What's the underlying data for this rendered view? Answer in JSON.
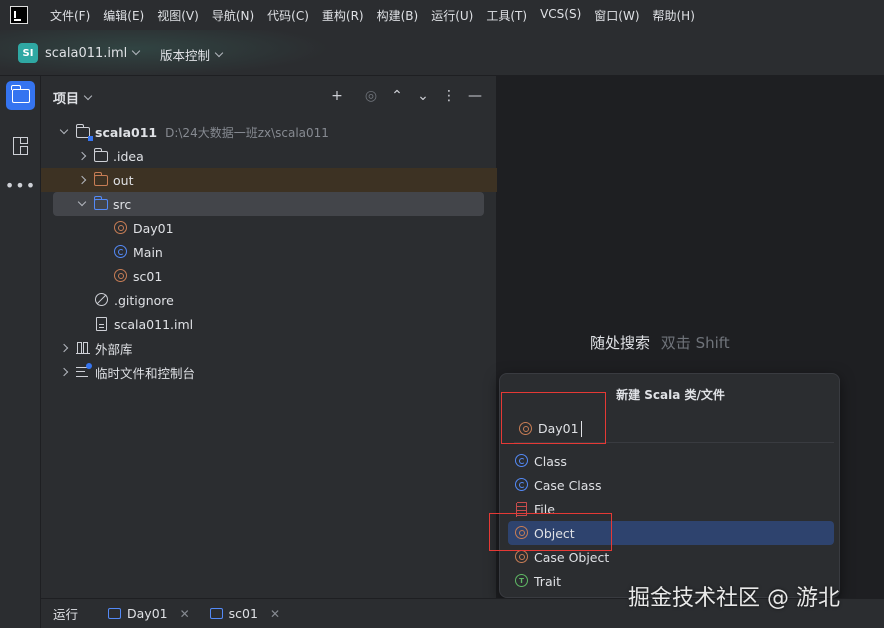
{
  "menu": {
    "items": [
      "文件(F)",
      "编辑(E)",
      "视图(V)",
      "导航(N)",
      "代码(C)",
      "重构(R)",
      "构建(B)",
      "运行(U)",
      "工具(T)",
      "VCS(S)",
      "窗口(W)",
      "帮助(H)"
    ]
  },
  "titlebar": {
    "project_badge": "SI",
    "project_name": "scala011.iml",
    "vcs_label": "版本控制"
  },
  "project_panel": {
    "title": "项目",
    "tree": [
      {
        "label": "scala011",
        "path": "D:\\24大数据一班zx\\scala011"
      },
      {
        "label": ".idea"
      },
      {
        "label": "out"
      },
      {
        "label": "src"
      },
      {
        "label": "Day01"
      },
      {
        "label": "Main"
      },
      {
        "label": "sc01"
      },
      {
        "label": ".gitignore"
      },
      {
        "label": "scala011.iml"
      },
      {
        "label": "外部库"
      },
      {
        "label": "临时文件和控制台"
      }
    ]
  },
  "editor": {
    "search_hint": "随处搜索",
    "search_hint_key": "双击 Shift"
  },
  "popup": {
    "title": "新建 Scala 类/文件",
    "input_value": "Day01",
    "options": [
      "Class",
      "Case Class",
      "File",
      "Object",
      "Case Object",
      "Trait"
    ],
    "selected": "Object"
  },
  "runbar": {
    "title": "运行",
    "tabs": [
      "Day01",
      "sc01"
    ]
  },
  "watermark": "掘金技术社区 @ 游北",
  "colors": {
    "accent": "#3574f0",
    "selection": "#2e436e",
    "annotation_red": "#e53935",
    "scala_object": "#c77d55",
    "scala_class": "#548af7"
  }
}
